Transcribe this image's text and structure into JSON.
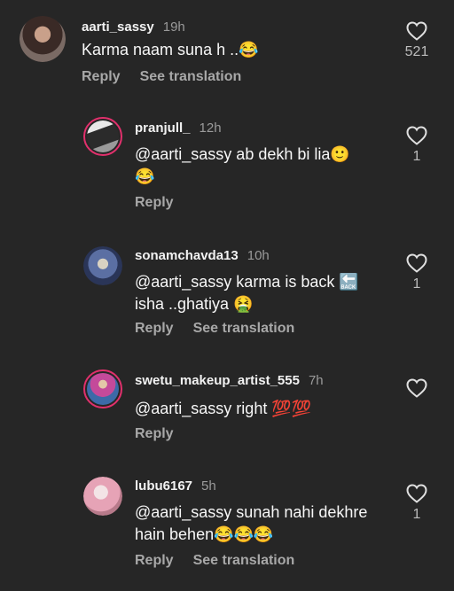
{
  "comments": [
    {
      "user": "aarti_sassy",
      "time": "19h",
      "text": "Karma naam suna h ..😂",
      "reply": "Reply",
      "translation": "See translation",
      "likes": "521"
    },
    {
      "user": "pranjull_",
      "time": "12h",
      "text": "@aarti_sassy ab dekh bi lia🙂 😂",
      "reply": "Reply",
      "translation": "",
      "likes": "1"
    },
    {
      "user": "sonamchavda13",
      "time": "10h",
      "text": "@aarti_sassy karma is back 🔙 isha ..ghatiya 🤮",
      "reply": "Reply",
      "translation": "See translation",
      "likes": "1"
    },
    {
      "user": "swetu_makeup_artist_555",
      "time": "7h",
      "text": "@aarti_sassy right 💯💯",
      "reply": "Reply",
      "translation": "",
      "likes": ""
    },
    {
      "user": "lubu6167",
      "time": "5h",
      "text": "@aarti_sassy sunah nahi dekhre hain behen😂😂😂",
      "reply": "Reply",
      "translation": "See translation",
      "likes": "1"
    }
  ],
  "colors": {
    "background": "#262626",
    "ring": "#e1306c",
    "muted": "#a8a8a8"
  },
  "icons": {
    "like": "heart-outline-icon"
  }
}
